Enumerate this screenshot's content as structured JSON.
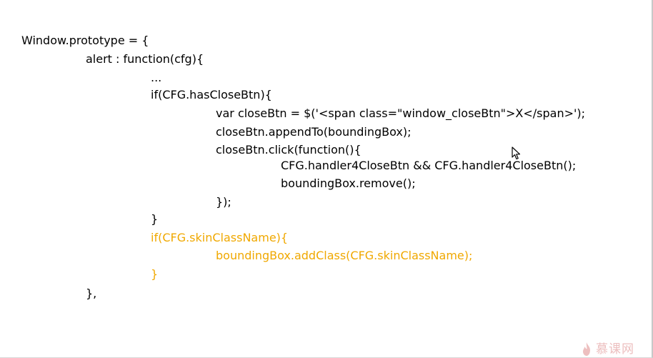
{
  "code": {
    "lines": [
      "Window.prototype = {",
      "alert : function(cfg){",
      "...",
      "if(CFG.hasCloseBtn){",
      "var closeBtn = $('<span class=\"window_closeBtn\">X</span>');",
      "closeBtn.appendTo(boundingBox);",
      "closeBtn.click(function(){",
      "CFG.handler4CloseBtn && CFG.handler4CloseBtn();",
      "boundingBox.remove();",
      "});",
      "}",
      "if(CFG.skinClassName){",
      "boundingBox.addClass(CFG.skinClassName);",
      "}",
      "},"
    ],
    "highlight_color": "#f0a800"
  },
  "watermark": {
    "text": "慕课网"
  }
}
